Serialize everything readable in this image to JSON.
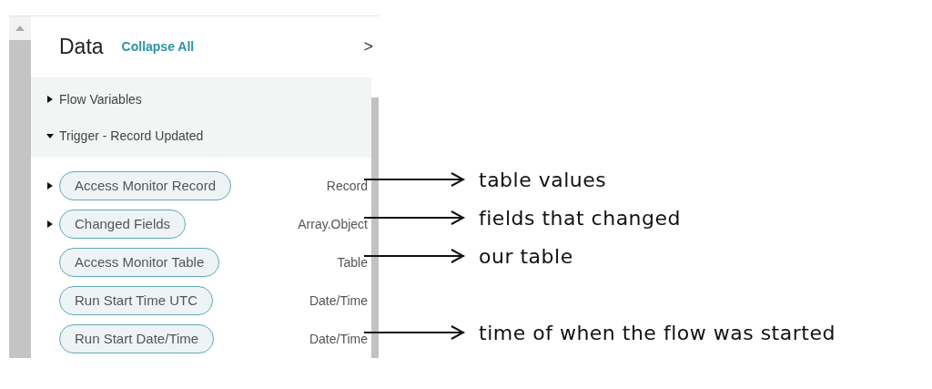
{
  "panel": {
    "title": "Data",
    "collapse_link": "Collapse All",
    "expand_glyph": ">"
  },
  "sections": [
    {
      "label": "Flow Variables",
      "expanded": false
    },
    {
      "label": "Trigger - Record Updated",
      "expanded": true
    }
  ],
  "rows": [
    {
      "name": "Access Monitor Record",
      "type": "Record",
      "kind": "expandable",
      "expanded": false,
      "annotation": "table values"
    },
    {
      "name": "Changed Fields",
      "type": "Array.Object",
      "kind": "expandable",
      "expanded": false,
      "annotation": "fields that changed"
    },
    {
      "name": "Access Monitor Table",
      "type": "Table",
      "kind": "plain",
      "annotation": "our table"
    },
    {
      "name": "Run Start Time UTC",
      "type": "Date/Time",
      "kind": "plain"
    },
    {
      "name": "Run Start Date/Time",
      "type": "Date/Time",
      "kind": "plain",
      "annotation": "time of when the flow was started"
    }
  ]
}
